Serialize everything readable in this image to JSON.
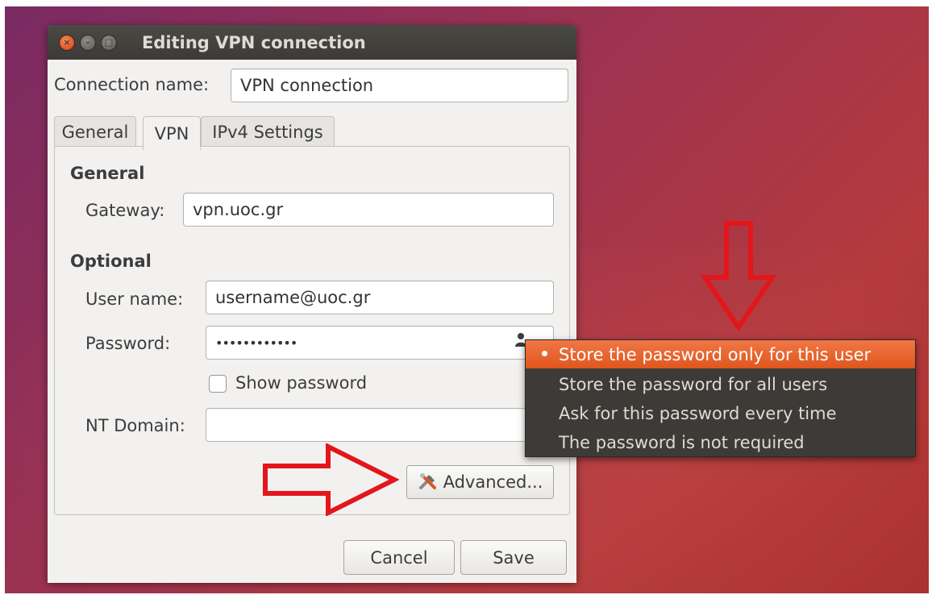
{
  "window": {
    "title": "Editing VPN connection"
  },
  "connection": {
    "name_label": "Connection name:",
    "name_value": "VPN connection"
  },
  "tabs": [
    {
      "label": "General"
    },
    {
      "label": "VPN"
    },
    {
      "label": "IPv4 Settings"
    }
  ],
  "vpn": {
    "general_heading": "General",
    "gateway_label": "Gateway:",
    "gateway_value": "vpn.uoc.gr",
    "optional_heading": "Optional",
    "username_label": "User name:",
    "username_value": "username@uoc.gr",
    "password_label": "Password:",
    "password_value": "••••••••••••",
    "show_password_label": "Show password",
    "nt_domain_label": "NT Domain:",
    "nt_domain_value": "",
    "advanced_label": "Advanced..."
  },
  "footer": {
    "cancel_label": "Cancel",
    "save_label": "Save"
  },
  "password_menu": {
    "items": [
      {
        "label": "Store the password only for this user",
        "selected": true
      },
      {
        "label": "Store the password for all users",
        "selected": false
      },
      {
        "label": "Ask for this password every time",
        "selected": false
      },
      {
        "label": "The password is not required",
        "selected": false
      }
    ]
  },
  "colors": {
    "accent": "#e95420",
    "annotation_arrow": "#e3161b",
    "titlebar": "#3c3b37"
  },
  "icons": {
    "password_storage": "person-icon",
    "advanced": "tools-icon"
  }
}
